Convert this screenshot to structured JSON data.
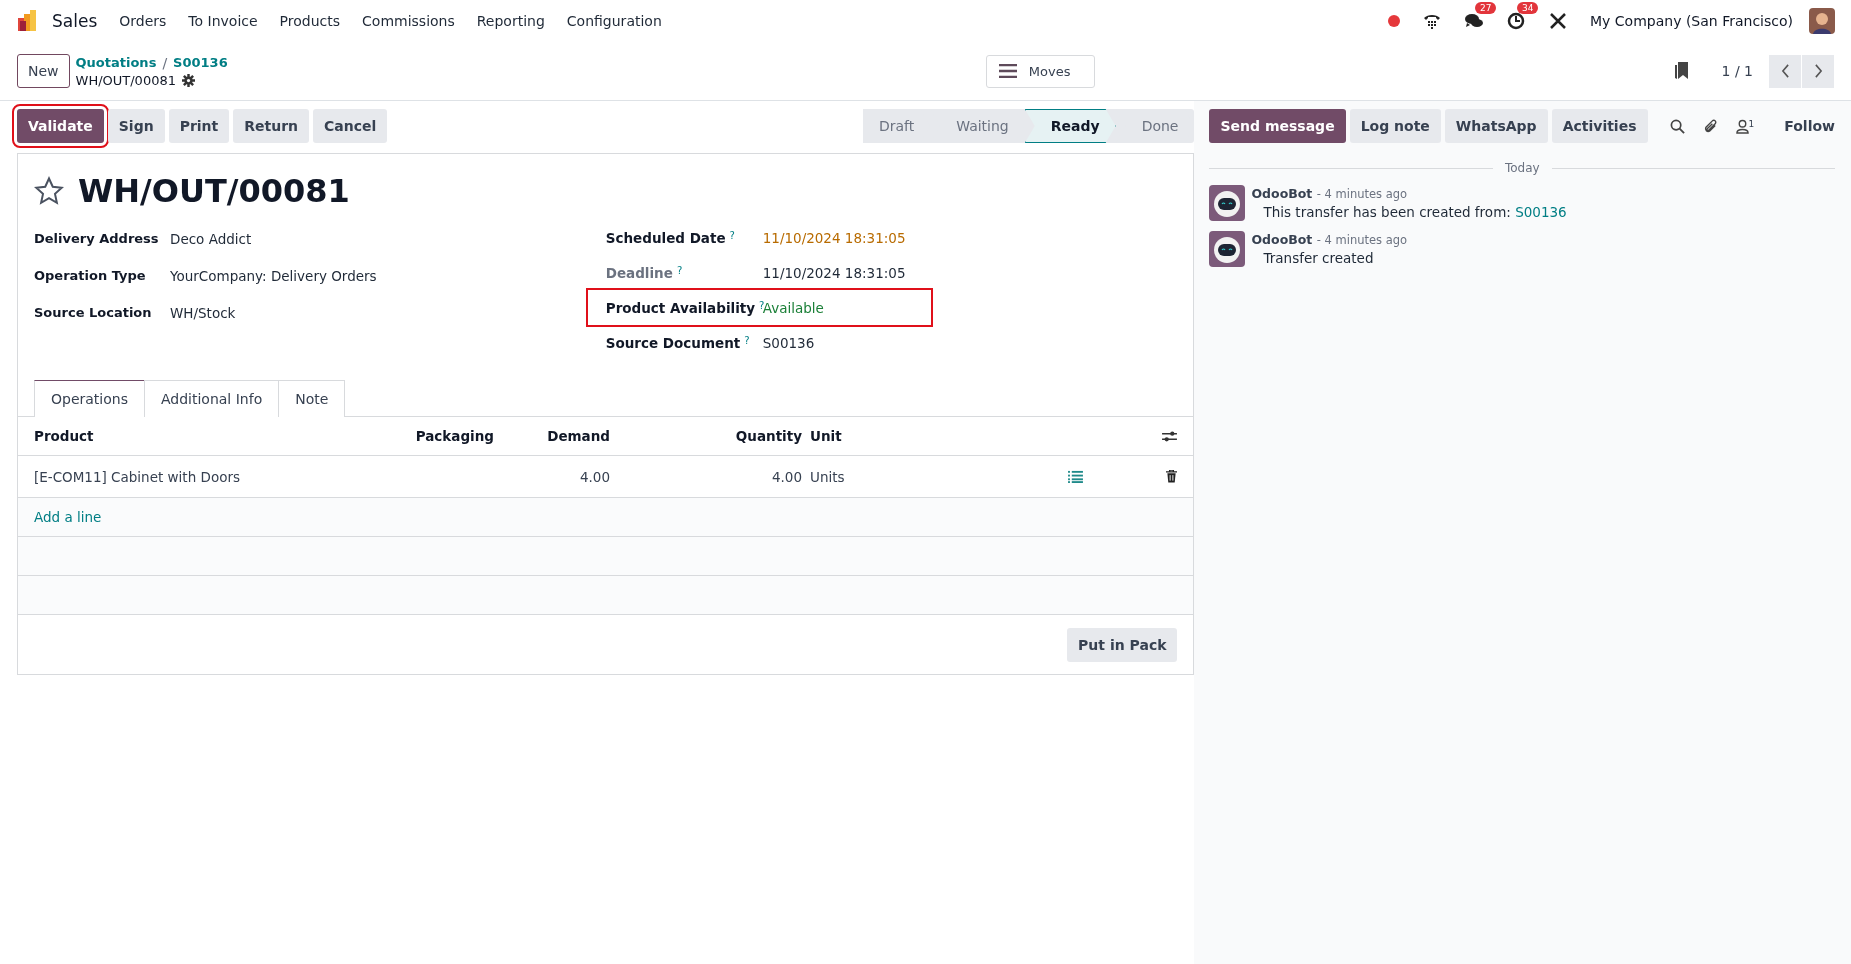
{
  "navbar": {
    "app": "Sales",
    "menu": [
      "Orders",
      "To Invoice",
      "Products",
      "Commissions",
      "Reporting",
      "Configuration"
    ],
    "messages_badge": "27",
    "activities_badge": "34",
    "company": "My Company (San Francisco)"
  },
  "control_panel": {
    "new_button": "New",
    "breadcrumbs": [
      "Quotations",
      "S00136"
    ],
    "separator": "/",
    "record": "WH/OUT/00081",
    "moves_button": "Moves",
    "pager": "1 / 1"
  },
  "actions": [
    {
      "label": "Validate",
      "primary": true,
      "highlighted": true
    },
    {
      "label": "Sign",
      "primary": false,
      "highlighted": false
    },
    {
      "label": "Print",
      "primary": false,
      "highlighted": false
    },
    {
      "label": "Return",
      "primary": false,
      "highlighted": false
    },
    {
      "label": "Cancel",
      "primary": false,
      "highlighted": false
    }
  ],
  "statusbar": [
    {
      "label": "Draft",
      "selected": false
    },
    {
      "label": "Waiting",
      "selected": false
    },
    {
      "label": "Ready",
      "selected": true
    },
    {
      "label": "Done",
      "selected": false
    }
  ],
  "form": {
    "title": "WH/OUT/00081",
    "starred": false,
    "left_fields": [
      {
        "label": "Delivery Address",
        "value": "Deco Addict"
      },
      {
        "label": "Operation Type",
        "value": "YourCompany: Delivery Orders"
      },
      {
        "label": "Source Location",
        "value": "WH/Stock"
      }
    ],
    "right_fields": [
      {
        "label": "Scheduled Date",
        "help": "?",
        "value": "11/10/2024 18:31:05",
        "color": "#b86b00",
        "muted": false,
        "highlighted": false
      },
      {
        "label": "Deadline",
        "help": "?",
        "value": "11/10/2024 18:31:05",
        "color": "#1f2937",
        "muted": true,
        "highlighted": false
      },
      {
        "label": "Product Availability",
        "help": "?",
        "value": "Available",
        "color": "#1a7f37",
        "muted": false,
        "highlighted": true
      },
      {
        "label": "Source Document",
        "help": "?",
        "value": "S00136",
        "color": "#1f2937",
        "muted": false,
        "highlighted": false
      }
    ],
    "tabs": [
      {
        "label": "Operations",
        "selected": true
      },
      {
        "label": "Additional Info",
        "selected": false
      },
      {
        "label": "Note",
        "selected": false
      }
    ],
    "table": {
      "columns": [
        "Product",
        "Packaging",
        "Demand",
        "Quantity",
        "Unit"
      ],
      "rows": [
        {
          "product": "[E-COM11] Cabinet with Doors",
          "demand": "4.00",
          "quantity": "4.00",
          "unit": "Units"
        }
      ],
      "add_line": "Add a line"
    },
    "put_in_pack": "Put in Pack"
  },
  "chatter": {
    "buttons": [
      {
        "label": "Send message",
        "primary": true
      },
      {
        "label": "Log note",
        "primary": false
      },
      {
        "label": "WhatsApp",
        "primary": false
      },
      {
        "label": "Activities",
        "primary": false
      }
    ],
    "followers_count": "1",
    "follow": "Follow",
    "date_divider": "Today",
    "messages": [
      {
        "author": "OdooBot",
        "time": "- 4 minutes ago",
        "body": "This transfer has been created from:",
        "link": "S00136"
      },
      {
        "author": "OdooBot",
        "time": "- 4 minutes ago",
        "body": "Transfer created"
      }
    ]
  }
}
